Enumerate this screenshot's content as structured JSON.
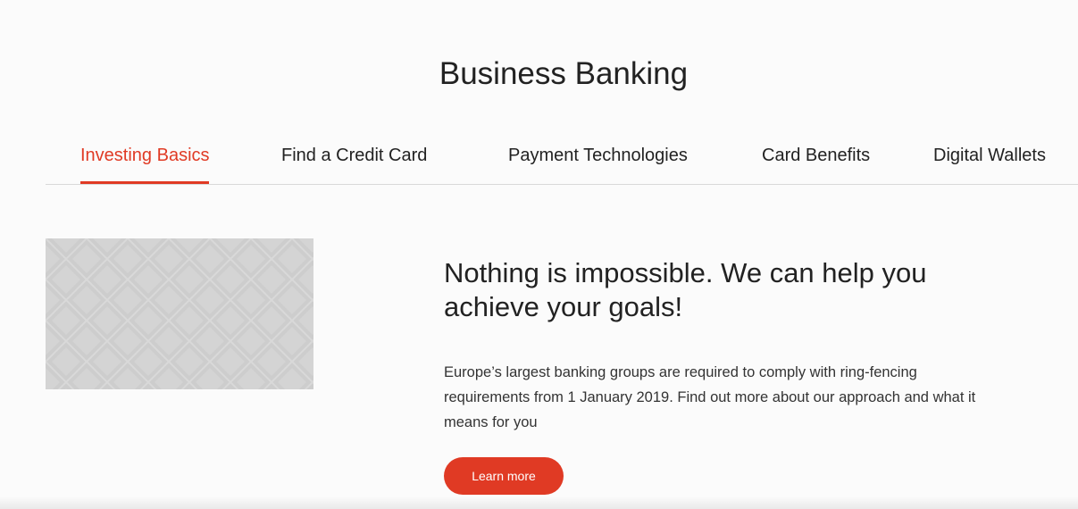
{
  "page": {
    "title": "Business Banking"
  },
  "tabs": [
    {
      "label": "Investing Basics",
      "active": true
    },
    {
      "label": "Find a Credit Card",
      "active": false
    },
    {
      "label": "Payment Technologies",
      "active": false
    },
    {
      "label": "Card Benefits",
      "active": false
    },
    {
      "label": "Digital Wallets",
      "active": false
    }
  ],
  "feature": {
    "headline": "Nothing is impossible. We can help you achieve your goals!",
    "body": "Europe’s largest banking groups are required to comply with ring-fencing requirements from 1 January 2019. Find out more about our approach and what it means for you",
    "cta_label": "Learn more"
  },
  "colors": {
    "accent": "#e03a24",
    "text": "#222222",
    "background": "#fbfbfb",
    "image_placeholder": "#d4d4d4"
  }
}
